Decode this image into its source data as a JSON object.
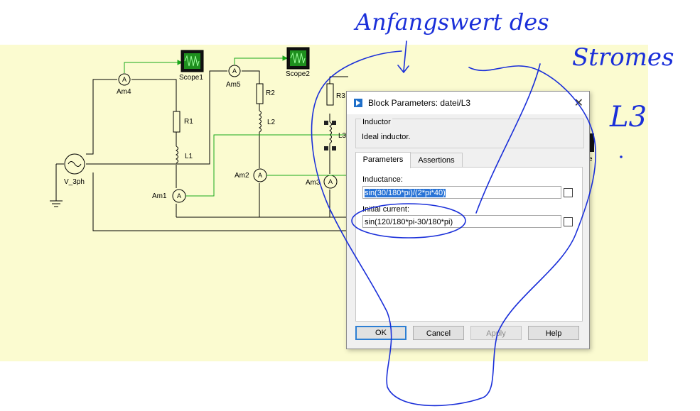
{
  "diagram": {
    "labels": {
      "am4": "Am4",
      "scope1": "Scope1",
      "am5": "Am5",
      "scope2": "Scope2",
      "r1": "R1",
      "l1": "L1",
      "r2": "R2",
      "l2": "L2",
      "r3": "R3",
      "l3": "L3",
      "am1": "Am1",
      "am2": "Am2",
      "am3": "Am3",
      "source": "V_3ph",
      "scope3_frag": "e"
    },
    "ammeter_glyph": "A"
  },
  "dialog": {
    "title": "Block Parameters: datei/L3",
    "group_title": "Inductor",
    "description": "Ideal inductor.",
    "tabs": [
      {
        "label": "Parameters"
      },
      {
        "label": "Assertions"
      }
    ],
    "fields": {
      "inductance_label": "Inductance:",
      "inductance_value": "sin(30/180*pi)/(2*pi*40)",
      "initial_current_label": "Initial current:",
      "initial_current_value": "sin(120/180*pi-30/180*pi)"
    },
    "buttons": {
      "ok": "OK",
      "cancel": "Cancel",
      "apply": "Apply",
      "help": "Help"
    }
  },
  "annotations": {
    "line1": "Anfangswert des",
    "line2": "Stromes",
    "line3": "L3"
  },
  "colors": {
    "ink": "#1a2fd9",
    "wire": "#000000",
    "signal": "#1aa81a",
    "canvas": "#fbfbd0"
  }
}
